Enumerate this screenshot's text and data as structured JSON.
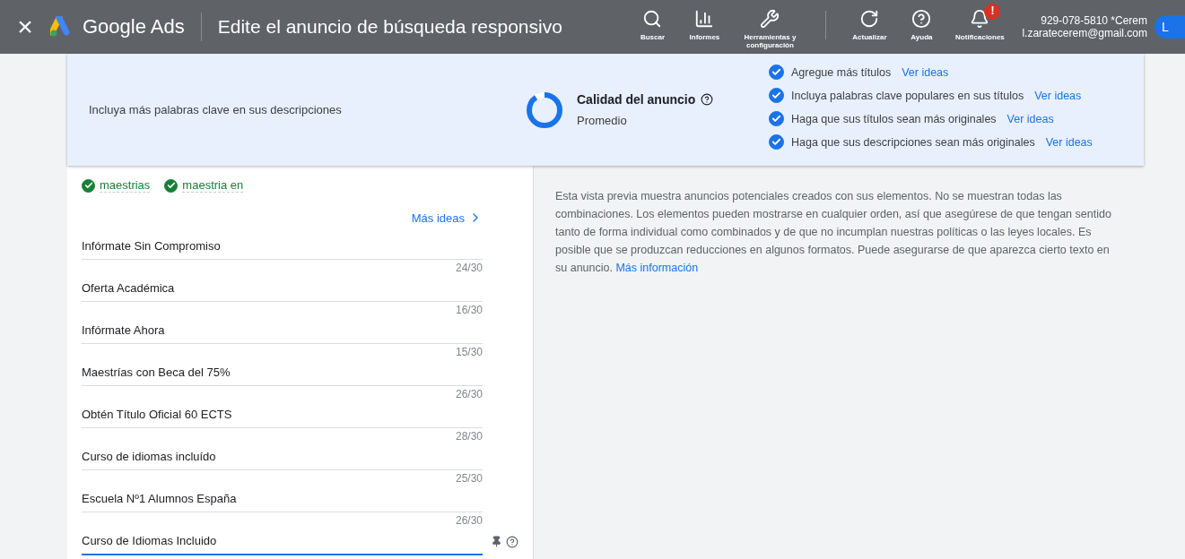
{
  "header": {
    "close": "×",
    "product": "Google Ads",
    "title": "Edite el anuncio de búsqueda responsivo",
    "tools": [
      {
        "kind": "search",
        "label": "Buscar"
      },
      {
        "kind": "reports",
        "label": "Informes"
      },
      {
        "kind": "tools",
        "label": "Herramientas y configuración"
      },
      {
        "kind": "divider"
      },
      {
        "kind": "refresh",
        "label": "Actualizar"
      },
      {
        "kind": "help",
        "label": "Ayuda"
      },
      {
        "kind": "bell",
        "label": "Notificaciones",
        "alert": "!"
      }
    ],
    "account": {
      "name": "929-078-5810 *Cerem",
      "email": "l.zaratecerem@gmail.com",
      "avatar": "L"
    }
  },
  "quality": {
    "hint": "Incluya más palabras clave en sus descripciones",
    "title": "Calidad del anuncio",
    "rating": "Promedio",
    "level": 0.9,
    "tips": [
      {
        "text": "Agregue más títulos",
        "link": "Ver ideas",
        "checked": true
      },
      {
        "text": "Incluya palabras clave populares en sus títulos",
        "link": "Ver ideas",
        "checked": true
      },
      {
        "text": "Haga que sus títulos sean más originales",
        "link": "Ver ideas",
        "checked": true
      },
      {
        "text": "Haga que sus descripciones sean más originales",
        "link": "Ver ideas",
        "checked": true
      }
    ]
  },
  "keywords": [
    {
      "text": "maestrias",
      "checked": true
    },
    {
      "text": "maestria en",
      "checked": true
    }
  ],
  "more_ideas": "Más ideas",
  "headlines": [
    {
      "value": "Infórmate Sin Compromiso",
      "count": "24/30",
      "focused": false
    },
    {
      "value": "Oferta Académica",
      "count": "16/30",
      "focused": false
    },
    {
      "value": "Infórmate Ahora",
      "count": "15/30",
      "focused": false
    },
    {
      "value": "Maestrías con Beca del 75%",
      "count": "26/30",
      "focused": false
    },
    {
      "value": "Obtén Título Oficial 60 ECTS",
      "count": "28/30",
      "focused": false
    },
    {
      "value": "Curso de idiomas incluído",
      "count": "25/30",
      "focused": false
    },
    {
      "value": "Escuela Nº1 Alumnos España",
      "count": "26/30",
      "focused": false
    },
    {
      "value": "Curso de Idiomas Incluido",
      "focused": true
    }
  ],
  "preview_note": {
    "text": "Esta vista previa muestra anuncios potenciales creados con sus elementos. No se muestran todas las combinaciones. Los elementos pueden mostrarse en cualquier orden, así que asegúrese de que tengan sentido tanto de forma individual como combinados y de que no incumplan nuestras políticas o las leyes locales. Es posible que se produzcan reducciones en algunos formatos. Puede asegurarse de que aparezca cierto texto en su anuncio.",
    "link": "Más información"
  }
}
